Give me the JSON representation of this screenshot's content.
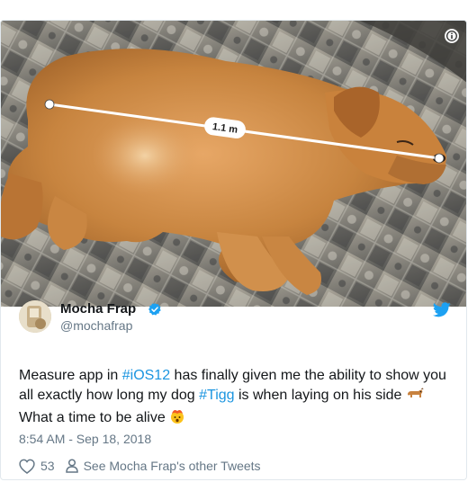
{
  "media": {
    "measurement_label": "1.1 m"
  },
  "icons": {
    "info": "info-icon",
    "verified": "verified-badge-icon",
    "bird": "twitter-bird-icon",
    "like": "heart-icon",
    "person": "person-icon"
  },
  "author": {
    "name": "Mocha Frap",
    "handle": "@mochafrap"
  },
  "tweet": {
    "line1_prefix": "Measure app in ",
    "hashtag1": "#iOS12",
    "line1_suffix": " has finally given me the ability to show you",
    "line2_prefix": "all exactly how long my dog ",
    "hashtag2": "#Tigg",
    "line2_suffix": " is when laying on his side",
    "line3": "What a time to be alive"
  },
  "timestamp": "8:54 AM - Sep 18, 2018",
  "actions": {
    "like_count": "53",
    "other_tweets_label": "See Mocha Frap's other Tweets"
  },
  "colors": {
    "hashtag": "#1b95e0",
    "twitter_blue": "#1da1f2",
    "meta_gray": "#657786"
  }
}
